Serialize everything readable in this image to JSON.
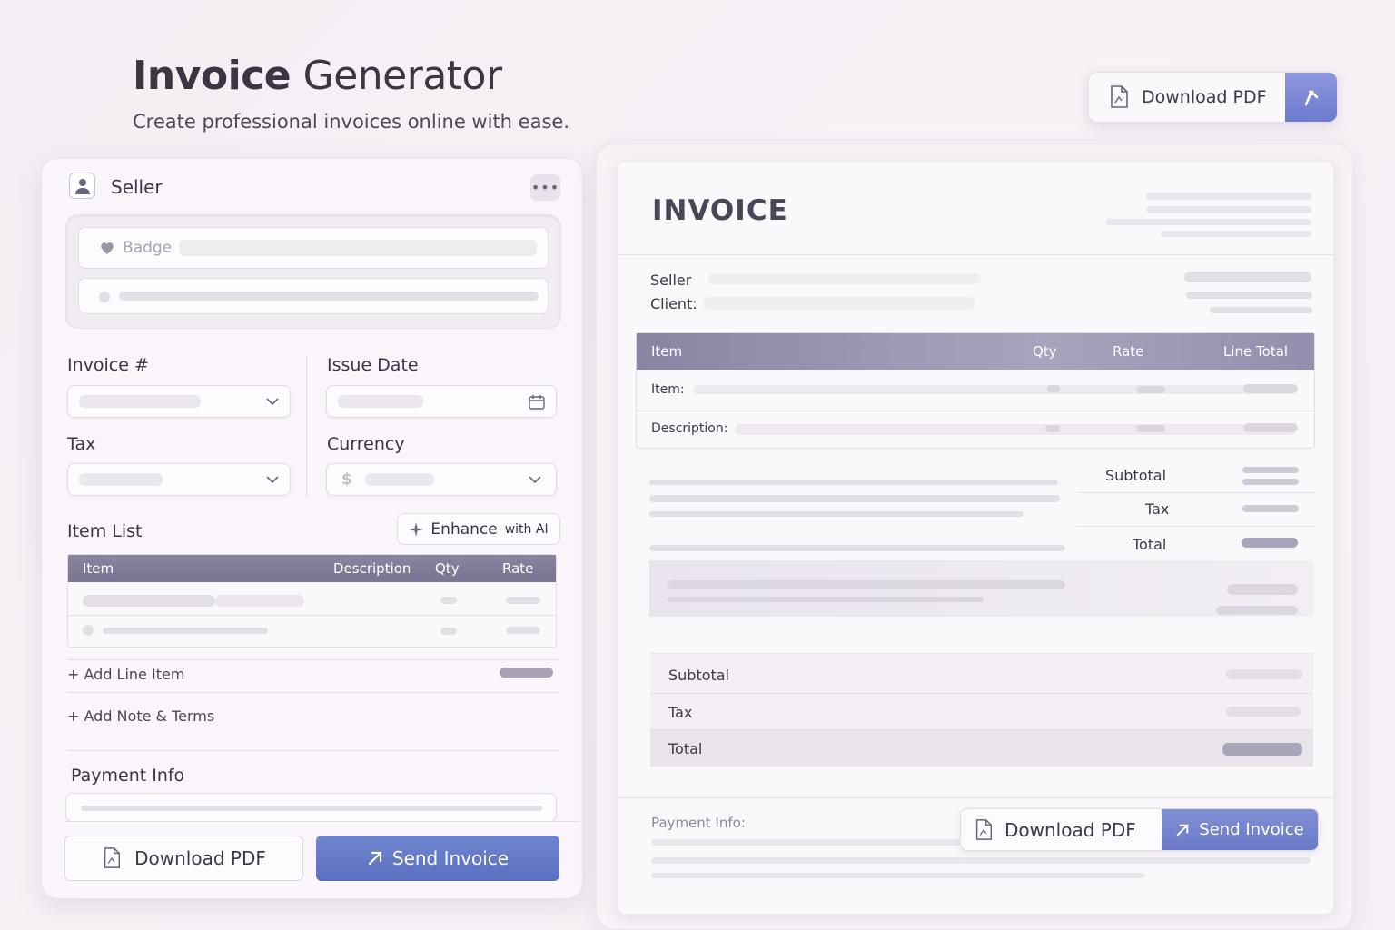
{
  "header": {
    "title_bold": "Invoice",
    "title_rest": "Generator",
    "subtitle": "Create professional invoices online with ease.",
    "download_label": "Download PDF"
  },
  "form": {
    "seller_label": "Seller",
    "more_label": "•••",
    "badge_placeholder": "Badge",
    "invoice_label": "Invoice #",
    "issue_date_label": "Issue Date",
    "tax_label": "Tax",
    "currency_label": "Currency",
    "currency_symbol": "$",
    "item_list_label": "Item List",
    "enhance_label": "Enhance",
    "enhance_small": "with AI",
    "table_headers": [
      "Item",
      "Description",
      "Qty",
      "Rate"
    ],
    "add_line_item": "+ Add Line Item",
    "add_note_terms": "+ Add Note & Terms",
    "payment_info_label": "Payment Info",
    "download_label": "Download PDF",
    "send_label": "Send Invoice"
  },
  "preview": {
    "invoice_title": "INVOICE",
    "seller_label": "Seller",
    "client_label": "Client:",
    "table_headers": [
      "Item",
      "Qty",
      "Rate",
      "Line Total"
    ],
    "row_item_label": "Item:",
    "row_desc_label": "Description:",
    "subtotal_label": "Subtotal",
    "tax_label": "Tax",
    "total_label": "Total",
    "summary_subtotal": "Subtotal",
    "summary_tax": "Tax",
    "summary_total": "Total",
    "payment_info_label": "Payment Info:",
    "download_label": "Download PDF",
    "send_label": "Send Invoice"
  },
  "colors": {
    "accent": "#6d7bd0",
    "primary_button": "#5b6fbf",
    "table_header": "#7a7391"
  }
}
